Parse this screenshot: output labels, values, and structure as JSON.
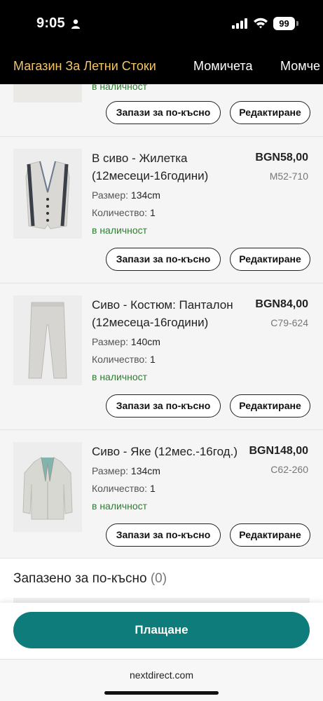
{
  "status_bar": {
    "time": "9:05",
    "battery": "99"
  },
  "nav": {
    "categories": [
      "Магазин За Летни Стоки",
      "Момичета",
      "Момче"
    ]
  },
  "cart": {
    "partial_item": {
      "stock": "в наличност",
      "save_label": "Запази за по-късно",
      "edit_label": "Редактиране"
    },
    "items": [
      {
        "title": "В сиво - Жилетка (12месеци-16години)",
        "price": "BGN58,00",
        "code": "M52-710",
        "size_label": "Размер:",
        "size": "134cm",
        "qty_label": "Количество:",
        "qty": "1",
        "stock": "в наличност",
        "save_label": "Запази за по-късно",
        "edit_label": "Редактиране"
      },
      {
        "title": "Сиво - Костюм: Панталон (12месеца-16години)",
        "price": "BGN84,00",
        "code": "C79-624",
        "size_label": "Размер:",
        "size": "140cm",
        "qty_label": "Количество:",
        "qty": "1",
        "stock": "в наличност",
        "save_label": "Запази за по-късно",
        "edit_label": "Редактиране"
      },
      {
        "title": "Сиво - Яке (12мес.-16год.)",
        "price": "BGN148,00",
        "code": "C62-260",
        "size_label": "Размер:",
        "size": "134cm",
        "qty_label": "Количество:",
        "qty": "1",
        "stock": "в наличност",
        "save_label": "Запази за по-късно",
        "edit_label": "Редактиране"
      }
    ]
  },
  "saved": {
    "title": "Запазено за по-късно",
    "count": "(0)"
  },
  "checkout": {
    "label": "Плащане"
  },
  "browser": {
    "url": "nextdirect.com"
  },
  "colors": {
    "accent": "#0e7c7b",
    "nav_active": "#f2c46b",
    "in_stock": "#2e7d32"
  }
}
